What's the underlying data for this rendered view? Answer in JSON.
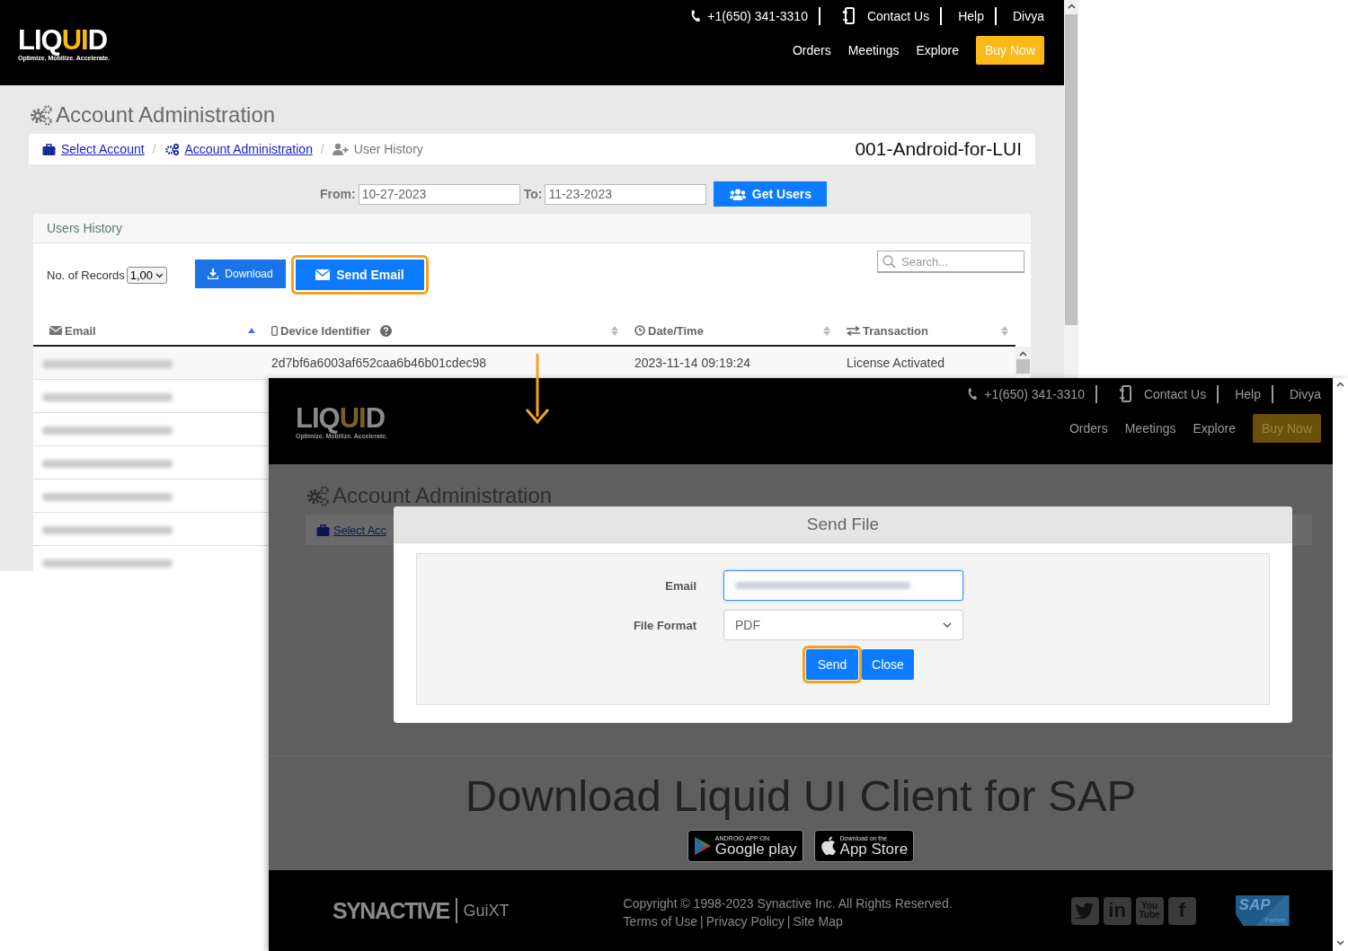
{
  "main_window": {
    "header": {
      "logo": [
        {
          "text": "LIQ",
          "accent": false
        },
        {
          "text": "UI",
          "accent": true
        },
        {
          "text": "D",
          "accent": false
        }
      ],
      "tagline": "Optimize. Mobilize. Accelerate.",
      "phone": "+1(650) 341-3310",
      "top_links": [
        "Contact Us",
        "Help",
        "Divya"
      ],
      "nav": [
        "Orders",
        "Meetings",
        "Explore"
      ],
      "cta": "Buy Now"
    },
    "page_title": "Account Administration",
    "breadcrumbs": [
      {
        "label": "Select Account",
        "kind": "link"
      },
      {
        "separator": "/",
        "label": "Account Administration",
        "kind": "link"
      },
      {
        "separator": "/",
        "label": "User History",
        "kind": "current"
      }
    ],
    "account_name": "001-Android-for-LUI",
    "date_filter": {
      "from_label": "From:",
      "from": "10-27-2023",
      "to_label": "To:",
      "to": "11-23-2023",
      "button": "Get Users"
    },
    "users_history": {
      "title": "Users History",
      "records_label": "No. of Records",
      "records_value": "1,00",
      "buttons": [
        {
          "label": "Download",
          "highlighted": false
        },
        {
          "label": "Send Email",
          "highlighted": true
        }
      ],
      "search_placeholder": "Search...",
      "columns": [
        {
          "label": "Email",
          "sorted": true,
          "help": false
        },
        {
          "label": "Device Identifier",
          "sorted": false,
          "help": true
        },
        {
          "label": "Date/Time",
          "sorted": false,
          "help": false
        },
        {
          "label": "Transaction",
          "sorted": false,
          "help": false
        }
      ],
      "rows": [
        {
          "email_blurred": true,
          "device": "2d7bf6a6003af652caa6b46b01cdec98",
          "datetime": "2023-11-14 09:19:24",
          "transaction": "License Activated"
        },
        {
          "email_blurred": true
        },
        {
          "email_blurred": true
        },
        {
          "email_blurred": true
        },
        {
          "email_blurred": true
        },
        {
          "email_blurred": true
        },
        {
          "email_blurred": true
        }
      ]
    }
  },
  "overlay_window": {
    "header": {
      "logo": [
        {
          "text": "LIQ",
          "accent": false
        },
        {
          "text": "UI",
          "accent": true
        },
        {
          "text": "D",
          "accent": false
        }
      ],
      "tagline": "Optimize. Mobilize. Accelerate.",
      "phone": "+1(650) 341-3310",
      "top_links": [
        "Contact Us",
        "Help",
        "Divya"
      ],
      "nav": [
        "Orders",
        "Meetings",
        "Explore"
      ],
      "cta": "Buy Now"
    },
    "page_title": "Account Administration",
    "breadcrumb_visible": "Select Acc",
    "dialog": {
      "title": "Send File",
      "fields": [
        {
          "label": "Email",
          "kind": "text",
          "value_blurred": true,
          "focused": true
        },
        {
          "label": "File Format",
          "kind": "select",
          "value": "PDF",
          "focused": false
        }
      ],
      "buttons": [
        {
          "label": "Send",
          "highlighted": true
        },
        {
          "label": "Close",
          "highlighted": false
        }
      ]
    },
    "promo": {
      "heading": "Download Liquid UI Client for SAP",
      "badges": [
        {
          "kind": "google",
          "small": "ANDROID APP ON",
          "big": "Google play"
        },
        {
          "kind": "apple",
          "small": "Download on the",
          "big": "App Store"
        }
      ]
    },
    "footer": {
      "brand": "SYNACTIVE",
      "product": "GuiXT",
      "copyright": "Copyright © 1998-2023 Synactive Inc. All Rights Reserved.",
      "links": [
        {
          "label": "Terms of Use"
        },
        {
          "separator": "|",
          "label": "Privacy Policy"
        },
        {
          "separator": "|",
          "label": "Site Map"
        }
      ],
      "social": [
        {
          "kind": "twitter"
        },
        {
          "kind": "linkedin",
          "glyph": "in"
        },
        {
          "kind": "youtube",
          "glyph": "You Tube"
        },
        {
          "kind": "facebook",
          "glyph": "f"
        }
      ],
      "partner": {
        "logo": "SAP",
        "label": "Partner"
      }
    }
  }
}
